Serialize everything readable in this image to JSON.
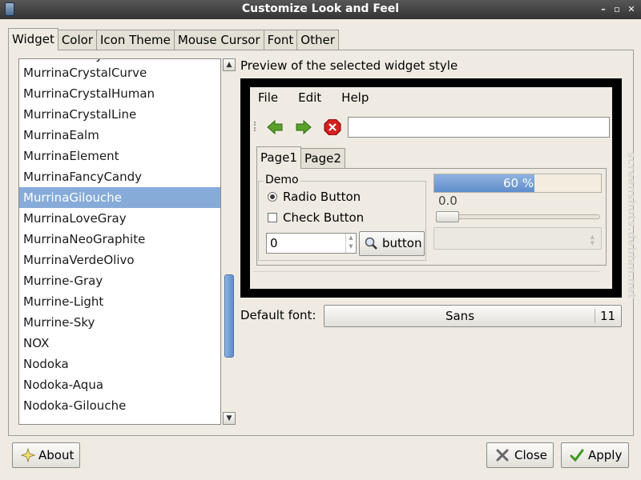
{
  "window": {
    "title": "Customize Look and Feel"
  },
  "tabs": [
    "Widget",
    "Color",
    "Icon Theme",
    "Mouse Cursor",
    "Font",
    "Other"
  ],
  "theme_list": {
    "items": [
      "MurrinaCrystalCurve",
      "MurrinaCrystalHuman",
      "MurrinaCrystalLine",
      "MurrinaEalm",
      "MurrinaElement",
      "MurrinaFancyCandy",
      "MurrinaGilouche",
      "MurrinaLoveGray",
      "MurrinaNeoGraphite",
      "MurrinaVerdeOlivo",
      "Murrine-Gray",
      "Murrine-Light",
      "Murrine-Sky",
      "NOX",
      "Nodoka",
      "Nodoka-Aqua",
      "Nodoka-Gilouche"
    ],
    "selected": "MurrinaGilouche"
  },
  "preview": {
    "label": "Preview of the selected widget style",
    "menu": [
      "File",
      "Edit",
      "Help"
    ],
    "tabs": [
      "Page1",
      "Page2"
    ],
    "demo_title": "Demo",
    "radio_label": "Radio Button",
    "check_label": "Check Button",
    "spin_value": "0",
    "button_label": "button",
    "progress_text": "60 %",
    "progress_fraction": 0.6,
    "scale_value": "0.0"
  },
  "font": {
    "label": "Default font:",
    "name": "Sans",
    "size": "11"
  },
  "buttons": {
    "about": "About",
    "close": "Close",
    "apply": "Apply"
  },
  "watermark": "screenshots.debian.net",
  "colors": {
    "selection": "#86abd9",
    "progress": "#6f9bd4"
  }
}
